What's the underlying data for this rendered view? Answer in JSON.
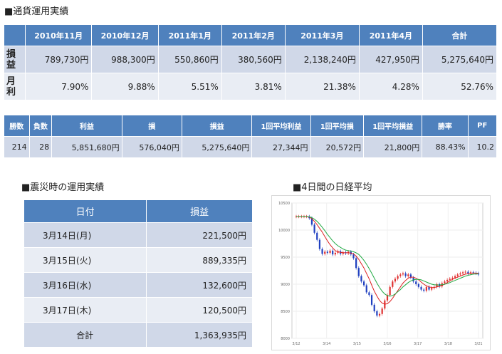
{
  "section1": {
    "title": "■通貨運用実績"
  },
  "monthly": {
    "headers": [
      "2010年11月",
      "2010年12月",
      "2011年1月",
      "2011年2月",
      "2011年3月",
      "2011年4月",
      "合計"
    ],
    "rows": [
      {
        "label": "損益",
        "values": [
          "789,730円",
          "988,300円",
          "550,860円",
          "380,560円",
          "2,138,240円",
          "427,950円",
          "5,275,640円"
        ]
      },
      {
        "label": "月利",
        "values": [
          "7.90%",
          "9.88%",
          "5.51%",
          "3.81%",
          "21.38%",
          "4.28%",
          "52.76%"
        ]
      }
    ]
  },
  "summary": {
    "headers": [
      "勝数",
      "負数",
      "利益",
      "損",
      "損益",
      "1回平均利益",
      "1回平均損",
      "1回平均損益",
      "勝率",
      "PF"
    ],
    "values": [
      "214",
      "28",
      "5,851,680円",
      "576,040円",
      "5,275,640円",
      "27,344円",
      "20,572円",
      "21,800円",
      "88.43%",
      "10.2"
    ]
  },
  "section2": {
    "title": "■震災時の運用実績"
  },
  "daily": {
    "headers": [
      "日付",
      "損益"
    ],
    "rows": [
      {
        "date": "3月14日(月)",
        "value": "221,500円"
      },
      {
        "date": "3月15日(火)",
        "value": "889,335円"
      },
      {
        "date": "3月16日(水)",
        "value": "132,600円"
      },
      {
        "date": "3月17日(木)",
        "value": "120,500円"
      }
    ],
    "total": {
      "label": "合計",
      "value": "1,363,935円"
    }
  },
  "section3": {
    "title": "■4日間の日経平均"
  },
  "chart_data": {
    "type": "candlestick",
    "title": "",
    "xlabel": "",
    "ylabel": "",
    "ylim": [
      8000,
      10500
    ],
    "yticks": [
      "10500",
      "10000",
      "9500",
      "9000",
      "8500",
      "8000"
    ],
    "xticks": [
      "3/12",
      "3/14",
      "3/15",
      "3/16",
      "3/17",
      "3/18",
      "3/21"
    ],
    "close": [
      10250,
      10250,
      10250,
      10250,
      10250,
      10220,
      10100,
      9950,
      9820,
      9650,
      9560,
      9600,
      9580,
      9620,
      9550,
      9580,
      9610,
      9560,
      9590,
      9570,
      9600,
      9550,
      9480,
      9300,
      9150,
      9050,
      8980,
      8850,
      8800,
      8620,
      8500,
      8420,
      8450,
      8550,
      8700,
      8800,
      8950,
      9050,
      9100,
      9150,
      9180,
      9200,
      9150,
      9180,
      9120,
      9050,
      9000,
      8950,
      8900,
      8880,
      8950,
      8900,
      8930,
      8950,
      9000,
      8960,
      9020,
      9050,
      9080,
      9100,
      9120,
      9150,
      9180,
      9200,
      9220,
      9230,
      9200,
      9220,
      9210,
      9200,
      9180
    ],
    "series": [
      {
        "name": "",
        "color": "#dd2222",
        "values": [
          10250,
          10250,
          10250,
          10250,
          10250,
          10240,
          10210,
          10160,
          10100,
          10030,
          9960,
          9880,
          9800,
          9730,
          9670,
          9620,
          9600,
          9590,
          9580,
          9580,
          9580,
          9575,
          9560,
          9520,
          9460,
          9380,
          9300,
          9200,
          9100,
          8980,
          8870,
          8780,
          8700,
          8650,
          8630,
          8640,
          8680,
          8740,
          8810,
          8880,
          8950,
          9020,
          9070,
          9110,
          9130,
          9130,
          9110,
          9080,
          9040,
          9000,
          8970,
          8950,
          8940,
          8940,
          8950,
          8960,
          8980,
          9000,
          9030,
          9060,
          9090,
          9110,
          9130,
          9150,
          9170,
          9185,
          9195,
          9200,
          9205,
          9205,
          9200
        ]
      },
      {
        "name": "",
        "color": "#22aa44",
        "values": [
          10250,
          10250,
          10250,
          10250,
          10250,
          10245,
          10230,
          10200,
          10160,
          10110,
          10050,
          9990,
          9920,
          9860,
          9800,
          9750,
          9710,
          9680,
          9650,
          9630,
          9620,
          9610,
          9600,
          9580,
          9550,
          9500,
          9440,
          9370,
          9290,
          9200,
          9110,
          9020,
          8940,
          8870,
          8820,
          8790,
          8780,
          8790,
          8820,
          8860,
          8900,
          8950,
          8990,
          9030,
          9060,
          9080,
          9090,
          9090,
          9080,
          9060,
          9040,
          9020,
          9000,
          8990,
          8985,
          8985,
          8990,
          9000,
          9010,
          9030,
          9050,
          9070,
          9090,
          9110,
          9130,
          9150,
          9165,
          9175,
          9185,
          9190,
          9190
        ]
      }
    ]
  }
}
